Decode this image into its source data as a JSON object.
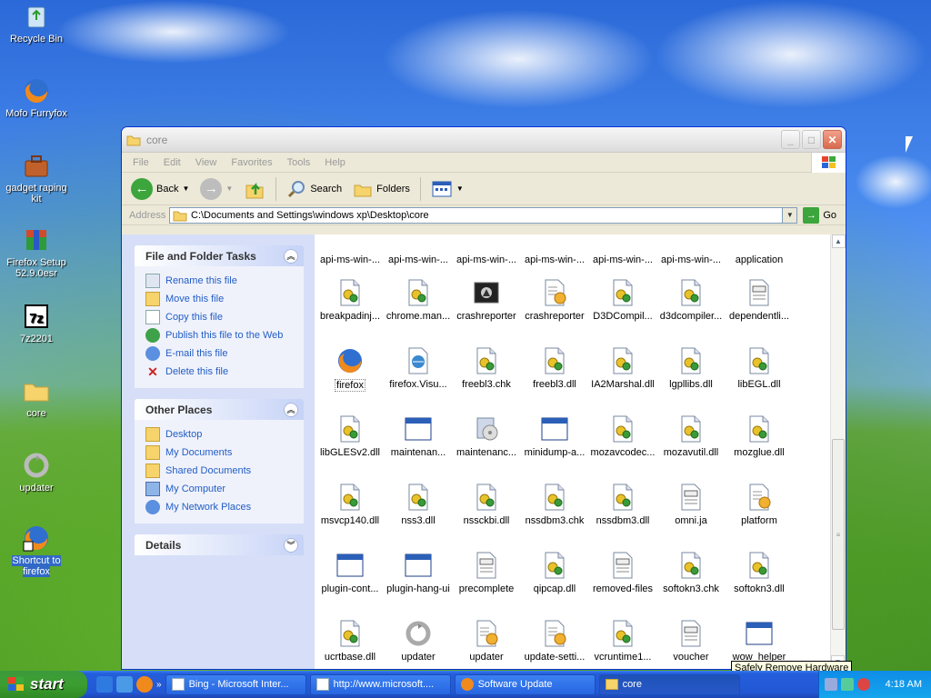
{
  "desktop": {
    "icons": [
      {
        "label": "Recycle Bin"
      },
      {
        "label": "Mofo Furryfox"
      },
      {
        "label": "gadget raping kit"
      },
      {
        "label": "Firefox Setup 52.9.0esr"
      },
      {
        "label": "7z2201"
      },
      {
        "label": "core"
      },
      {
        "label": "updater"
      },
      {
        "label": "Shortcut to firefox"
      }
    ]
  },
  "window": {
    "title": "core",
    "menu": [
      "File",
      "Edit",
      "View",
      "Favorites",
      "Tools",
      "Help"
    ],
    "toolbar": {
      "back": "Back",
      "search": "Search",
      "folders": "Folders"
    },
    "address": {
      "label": "Address",
      "value": "C:\\Documents and Settings\\windows xp\\Desktop\\core",
      "go": "Go"
    }
  },
  "task_pane": {
    "file_tasks": {
      "title": "File and Folder Tasks",
      "items": [
        "Rename this file",
        "Move this file",
        "Copy this file",
        "Publish this file to the Web",
        "E-mail this file",
        "Delete this file"
      ]
    },
    "other_places": {
      "title": "Other Places",
      "items": [
        "Desktop",
        "My Documents",
        "Shared Documents",
        "My Computer",
        "My Network Places"
      ]
    },
    "details": {
      "title": "Details"
    }
  },
  "files": [
    {
      "label": "api-ms-win-...",
      "icon": "dll"
    },
    {
      "label": "api-ms-win-...",
      "icon": "dll"
    },
    {
      "label": "api-ms-win-...",
      "icon": "dll"
    },
    {
      "label": "api-ms-win-...",
      "icon": "dll"
    },
    {
      "label": "api-ms-win-...",
      "icon": "dll"
    },
    {
      "label": "api-ms-win-...",
      "icon": "dll"
    },
    {
      "label": "application",
      "icon": "config"
    },
    {
      "label": "breakpadinj...",
      "icon": "dll"
    },
    {
      "label": "chrome.man...",
      "icon": "dll"
    },
    {
      "label": "crashreporter",
      "icon": "app-dark"
    },
    {
      "label": "crashreporter",
      "icon": "config"
    },
    {
      "label": "D3DCompil...",
      "icon": "dll"
    },
    {
      "label": "d3dcompiler...",
      "icon": "dll"
    },
    {
      "label": "dependentli...",
      "icon": "text"
    },
    {
      "label": "firefox",
      "icon": "firefox"
    },
    {
      "label": "firefox.Visu...",
      "icon": "manifest"
    },
    {
      "label": "freebl3.chk",
      "icon": "dll"
    },
    {
      "label": "freebl3.dll",
      "icon": "dll"
    },
    {
      "label": "IA2Marshal.dll",
      "icon": "dll"
    },
    {
      "label": "lgpllibs.dll",
      "icon": "dll"
    },
    {
      "label": "libEGL.dll",
      "icon": "dll"
    },
    {
      "label": "libGLESv2.dll",
      "icon": "dll"
    },
    {
      "label": "maintenan...",
      "icon": "window"
    },
    {
      "label": "maintenanc...",
      "icon": "installer"
    },
    {
      "label": "minidump-a...",
      "icon": "window"
    },
    {
      "label": "mozavcodec...",
      "icon": "dll"
    },
    {
      "label": "mozavutil.dll",
      "icon": "dll"
    },
    {
      "label": "mozglue.dll",
      "icon": "dll"
    },
    {
      "label": "msvcp140.dll",
      "icon": "dll"
    },
    {
      "label": "nss3.dll",
      "icon": "dll"
    },
    {
      "label": "nssckbi.dll",
      "icon": "dll"
    },
    {
      "label": "nssdbm3.chk",
      "icon": "dll"
    },
    {
      "label": "nssdbm3.dll",
      "icon": "dll"
    },
    {
      "label": "omni.ja",
      "icon": "text"
    },
    {
      "label": "platform",
      "icon": "config"
    },
    {
      "label": "plugin-cont...",
      "icon": "window"
    },
    {
      "label": "plugin-hang-ui",
      "icon": "window"
    },
    {
      "label": "precomplete",
      "icon": "text"
    },
    {
      "label": "qipcap.dll",
      "icon": "dll"
    },
    {
      "label": "removed-files",
      "icon": "text"
    },
    {
      "label": "softokn3.chk",
      "icon": "dll"
    },
    {
      "label": "softokn3.dll",
      "icon": "dll"
    },
    {
      "label": "ucrtbase.dll",
      "icon": "dll"
    },
    {
      "label": "updater",
      "icon": "updater"
    },
    {
      "label": "updater",
      "icon": "config"
    },
    {
      "label": "update-setti...",
      "icon": "config"
    },
    {
      "label": "vcruntime1...",
      "icon": "dll"
    },
    {
      "label": "voucher",
      "icon": "text"
    },
    {
      "label": "wow_helper",
      "icon": "window"
    }
  ],
  "taskbar": {
    "start": "start",
    "tasks": [
      {
        "label": "Bing - Microsoft Inter..."
      },
      {
        "label": "http://www.microsoft...."
      },
      {
        "label": "Software Update"
      },
      {
        "label": "core"
      }
    ],
    "clock": "4:18 AM"
  },
  "tooltip": "Safely Remove Hardware",
  "colors": {
    "taskbar_blue": "#245edb",
    "start_green": "#3c9e30",
    "taskpane_link": "#215dc6",
    "window_border": "#0831d9"
  }
}
